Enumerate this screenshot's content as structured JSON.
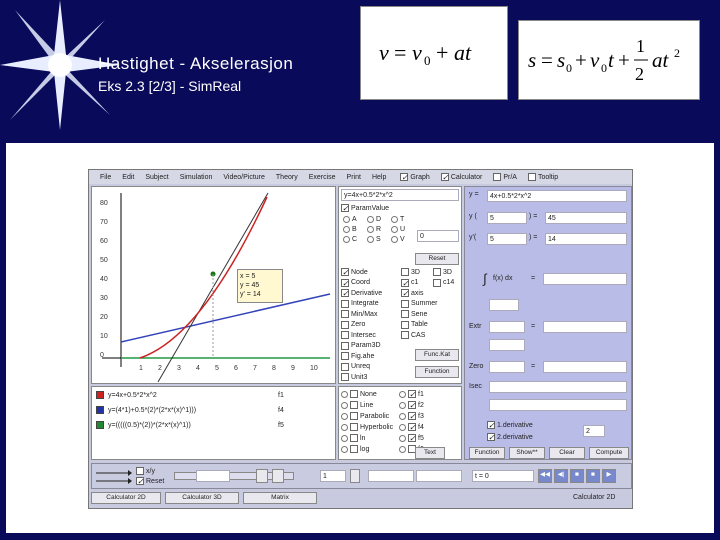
{
  "slide": {
    "title": "Hastighet  -  Akselerasjon",
    "subtitle": "Eks 2.3   [2/3]   -   SimReal",
    "formula_velocity": "v = v0 + at",
    "formula_position": "s = s0 + v0t + 1/2 at²"
  },
  "app": {
    "menu": [
      "File",
      "Edit",
      "Subject",
      "Simulation",
      "Video/Picture",
      "Theory",
      "Exercise",
      "Print",
      "Help"
    ],
    "toggles": [
      {
        "label": "Graph",
        "on": true
      },
      {
        "label": "Calculator",
        "on": true
      },
      {
        "label": "Pr/A",
        "on": false
      },
      {
        "label": "Tooltip",
        "on": false
      }
    ],
    "graph": {
      "y_ticks": [
        "80",
        "70",
        "60",
        "50",
        "40",
        "30",
        "20",
        "10",
        "0"
      ],
      "x_ticks": [
        "1",
        "2",
        "3",
        "4",
        "5",
        "6",
        "7",
        "8",
        "9",
        "10"
      ],
      "readout": [
        "x = 5",
        "y = 45",
        "y' = 14"
      ]
    },
    "func_header": "y=4x+0.5*2*x^2",
    "param_value_label": "ParamValue",
    "params": [
      "A",
      "B",
      "C",
      "D",
      "R",
      "S",
      "T",
      "U",
      "V"
    ],
    "param_value": "0",
    "reset_label": "Reset",
    "options_left": [
      "Node",
      "Coord",
      "Derivative",
      "Integrate",
      "Min/Max",
      "Zero",
      "Intersec",
      "Param3D",
      "Fig.ahe",
      "Unreq",
      "Unit3"
    ],
    "options_right": [
      "3D",
      "c1",
      "axis",
      "Summer",
      "Sene",
      "Table",
      "CAS"
    ],
    "options_right2": [
      "3D",
      "c14"
    ],
    "small_buttons": [
      "Func.Kat",
      "Function"
    ],
    "functions": [
      {
        "expr": "y=4x+0.5*2*x^2",
        "val": "f1",
        "color": "#cc2222"
      },
      {
        "expr": "y=(4*1)+0.5*(2)*(2*x*(x)^1)))",
        "val": "f4",
        "color": "#2233aa"
      },
      {
        "expr": "y=(((((0.5)*(2))*(2*x*(x)^1))",
        "val": "f5",
        "color": "#228833"
      }
    ],
    "func_types": [
      "None",
      "Line",
      "Parabolic",
      "Hyperbolic",
      "ln",
      "log"
    ],
    "func_ids": [
      "f1",
      "f2",
      "f3",
      "f4",
      "f5",
      "f6"
    ],
    "text_button": "Text",
    "calc": {
      "y_label": "y =",
      "y_expr": "4x+0.5*2*x^2",
      "yx_label": "y (",
      "yx_arg": "5",
      "yx_eq": ") =",
      "yx_val": "45",
      "ydx_label": "y'(",
      "ydx_arg": "5",
      "ydx_val": "14",
      "integral_label": "f(x) dx",
      "extr_label": "Extr",
      "zero_label": "Zero",
      "isec_label": "Isec",
      "eq": "=",
      "deriv1": "1.derivative",
      "deriv2": "2.derivative",
      "deriv_value": "2",
      "buttons": [
        "Function",
        "Show**",
        "Clear",
        "Compute"
      ]
    },
    "bottom": {
      "xy_label": "x/y",
      "reset_label": "Reset",
      "value": "1",
      "time_field": "t = 0",
      "tabs": [
        "Calculator 2D",
        "Calculator 3D",
        "Matrix"
      ],
      "status": "Calculator 2D"
    }
  }
}
